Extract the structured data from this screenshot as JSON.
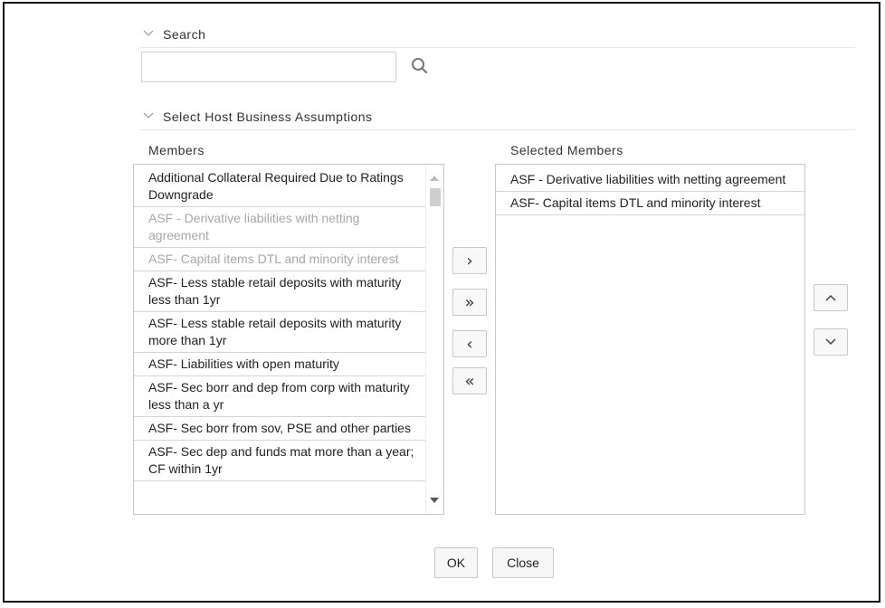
{
  "search_section": {
    "title": "Search",
    "input_value": "",
    "icon": "search-icon"
  },
  "assumptions_section": {
    "title": "Select Host Business Assumptions"
  },
  "members": {
    "label": "Members",
    "items": [
      {
        "text": "Additional Collateral Required Due to Ratings Downgrade",
        "disabled": false
      },
      {
        "text": "ASF - Derivative liabilities with netting agreement",
        "disabled": true
      },
      {
        "text": "ASF- Capital items DTL and minority interest",
        "disabled": true
      },
      {
        "text": "ASF- Less stable retail deposits with maturity less than 1yr",
        "disabled": false
      },
      {
        "text": "ASF- Less stable retail deposits with maturity more than 1yr",
        "disabled": false
      },
      {
        "text": "ASF- Liabilities with open maturity",
        "disabled": false
      },
      {
        "text": "ASF- Sec borr and dep from corp with maturity less than a yr",
        "disabled": false
      },
      {
        "text": "ASF- Sec borr from sov, PSE and other parties",
        "disabled": false
      },
      {
        "text": "ASF- Sec dep and funds mat more than a year; CF within 1yr",
        "disabled": false
      }
    ]
  },
  "selected_members": {
    "label": "Selected Members",
    "items": [
      {
        "text": "ASF - Derivative liabilities with netting agreement"
      },
      {
        "text": "ASF- Capital items DTL and minority interest"
      }
    ]
  },
  "shuttle_buttons": {
    "move": "›",
    "move_all": "»",
    "remove": "‹",
    "remove_all": "«"
  },
  "footer": {
    "ok_label": "OK",
    "close_label": "Close"
  }
}
